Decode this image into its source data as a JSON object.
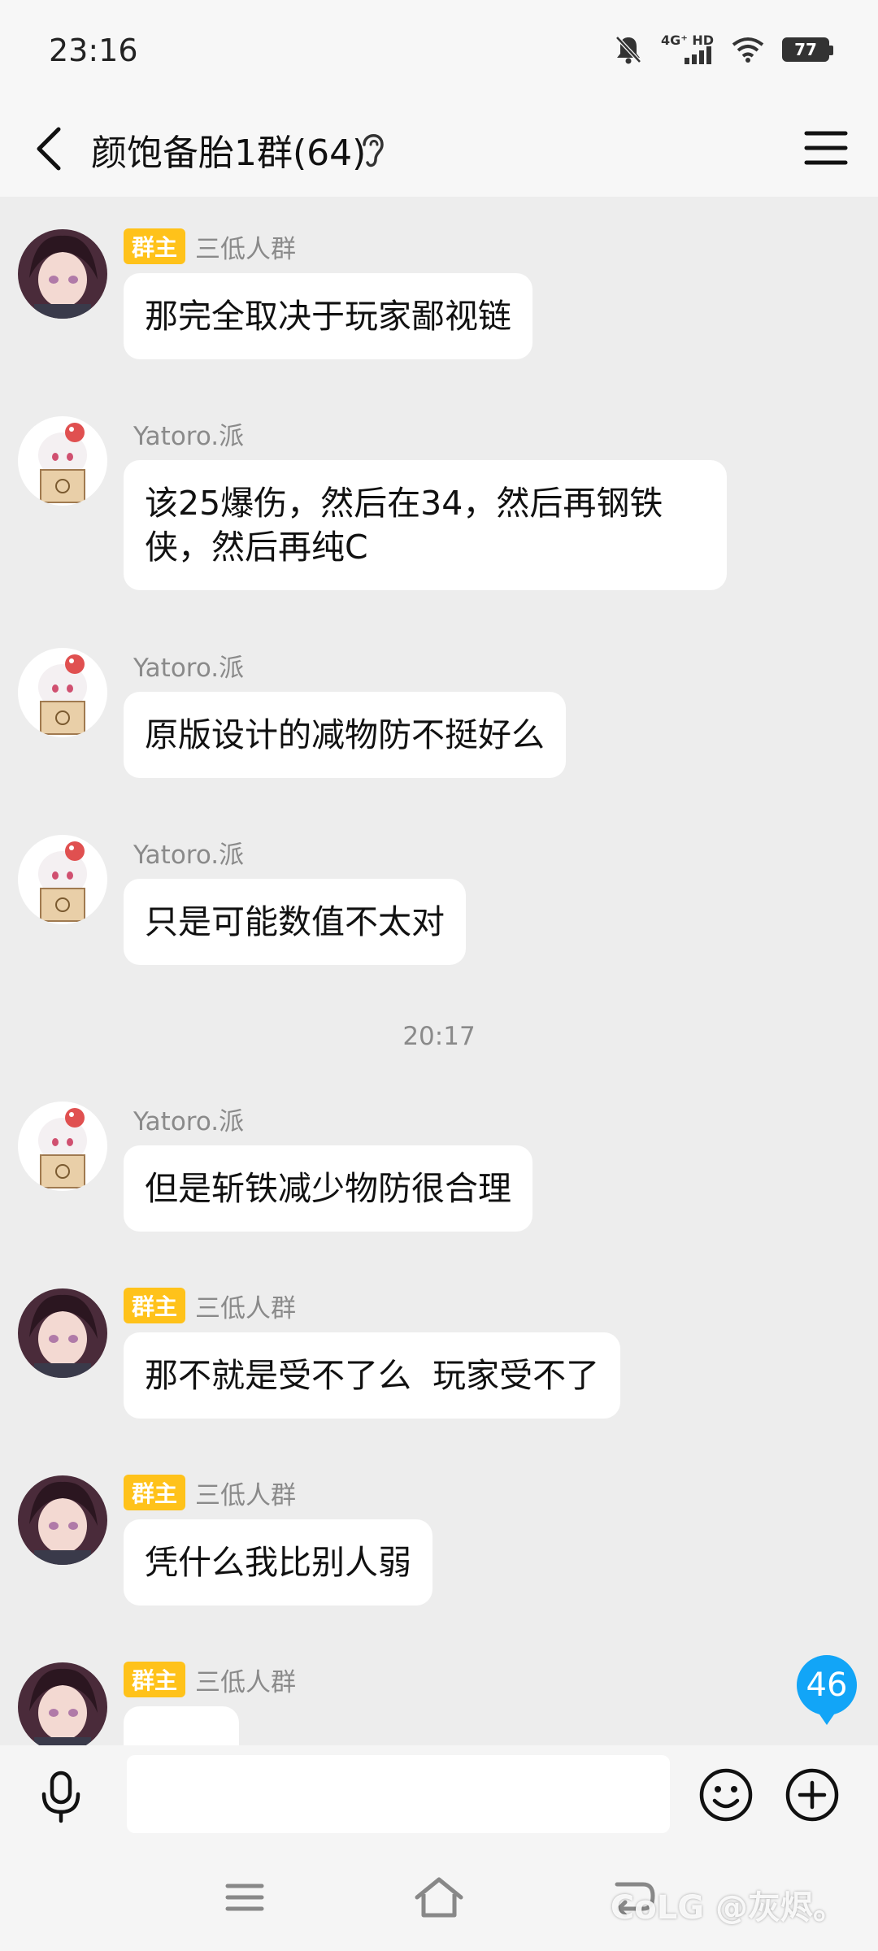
{
  "status": {
    "time": "23:16",
    "network": "4G⁺ HD",
    "battery": "77"
  },
  "header": {
    "title": "颜饱备胎1群(64)"
  },
  "messages": [
    {
      "sender": "三低人群",
      "badge": "群主",
      "avatar": "avatar-a",
      "text": "那完全取决于玩家鄙视链"
    },
    {
      "sender": "Yatoro.派",
      "badge": "",
      "avatar": "avatar-b",
      "text": "该25爆伤，然后在34，然后再钢铁侠，然后再纯C"
    },
    {
      "sender": "Yatoro.派",
      "badge": "",
      "avatar": "avatar-b",
      "text": "原版设计的减物防不挺好么"
    },
    {
      "sender": "Yatoro.派",
      "badge": "",
      "avatar": "avatar-b",
      "text": "只是可能数值不太对"
    },
    {
      "sender": "Yatoro.派",
      "badge": "",
      "avatar": "avatar-b",
      "text": "但是斩铁减少物防很合理"
    },
    {
      "sender": "三低人群",
      "badge": "群主",
      "avatar": "avatar-a",
      "text": "那不就是受不了么  玩家受不了"
    },
    {
      "sender": "三低人群",
      "badge": "群主",
      "avatar": "avatar-a",
      "text": "凭什么我比别人弱"
    },
    {
      "sender": "三低人群",
      "badge": "群主",
      "avatar": "avatar-a",
      "text": ""
    }
  ],
  "time_separator": "20:17",
  "unread_count": "46",
  "input": {
    "placeholder": ""
  },
  "watermark": "CoLG @灰烬。",
  "colors": {
    "badge_owner": "#ffc21a",
    "unread": "#12a5f7",
    "chat_bg": "#ededed"
  },
  "icons": {
    "back": "chevron-left-icon",
    "ear": "ear-icon",
    "menu": "hamburger-icon",
    "mic": "microphone-icon",
    "emoji": "smiley-icon",
    "plus": "plus-circle-icon"
  }
}
